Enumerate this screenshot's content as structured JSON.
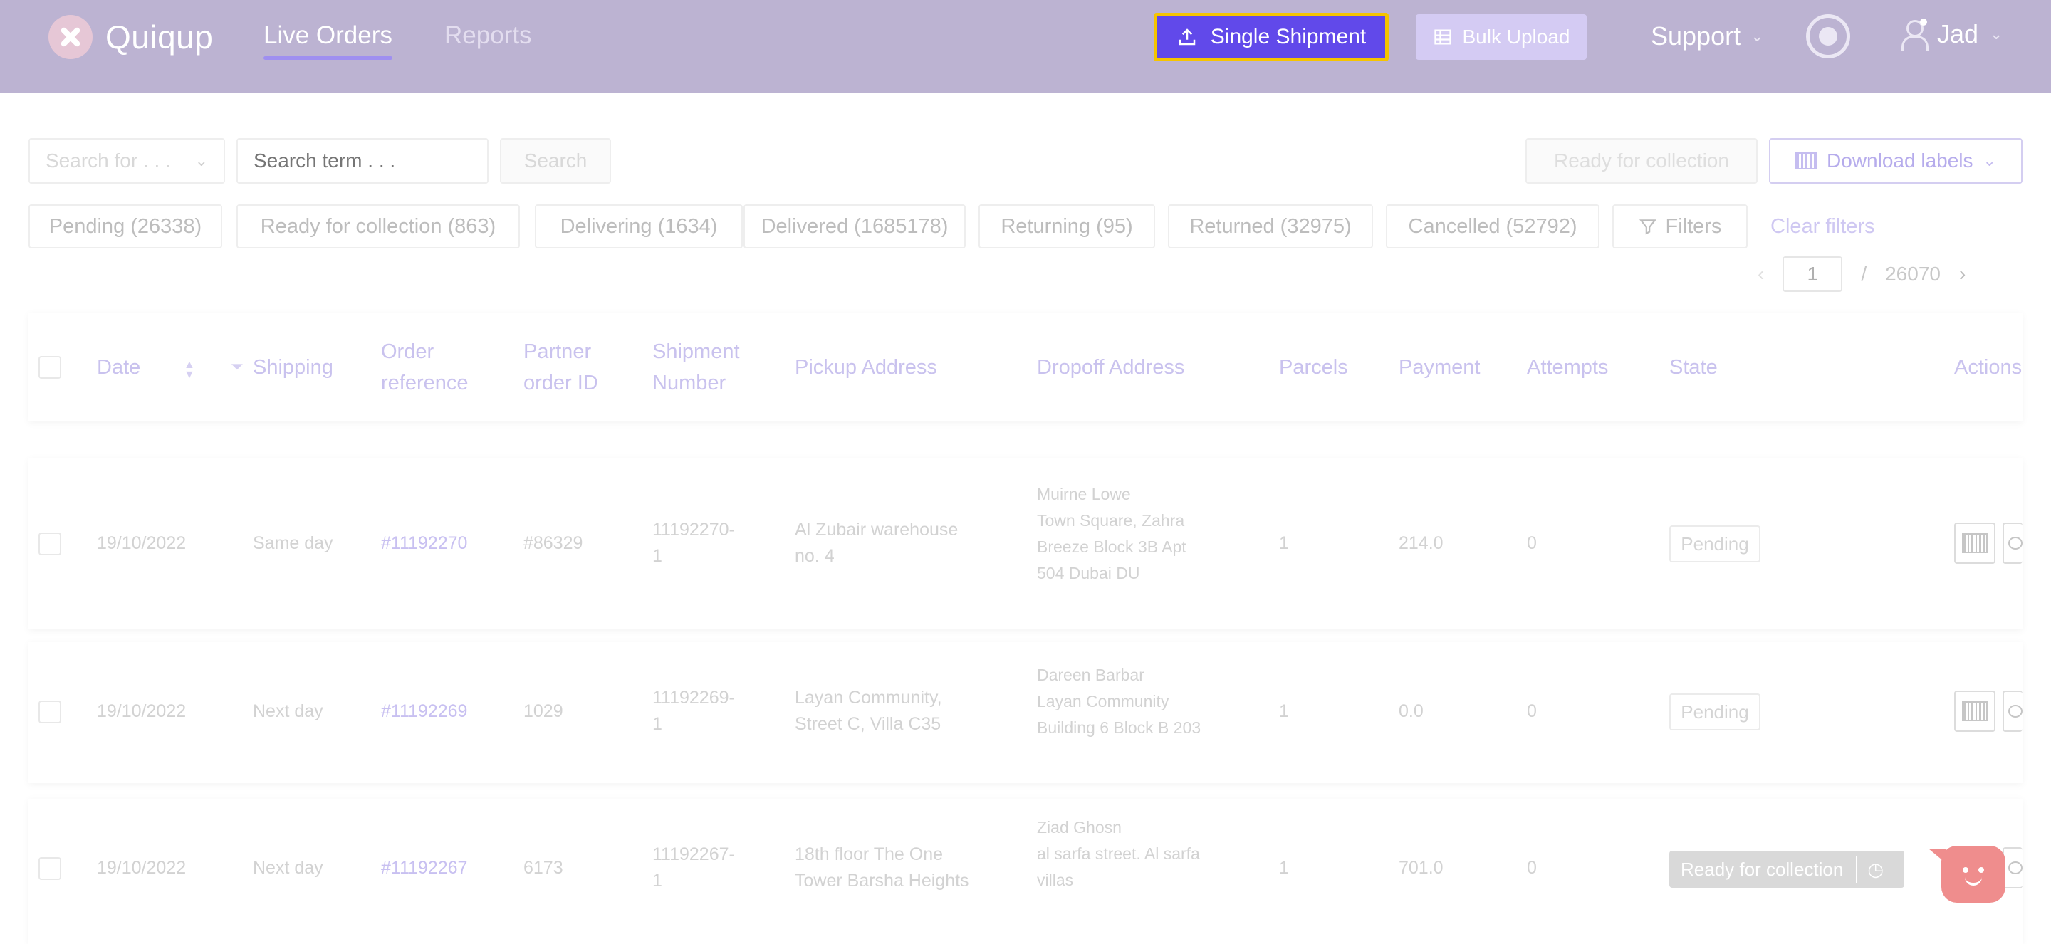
{
  "header": {
    "logo_text": "Quiqup",
    "tabs": [
      "Live Orders",
      "Reports"
    ],
    "single_shipment_label": "Single Shipment",
    "bulk_upload_label": "Bulk Upload",
    "support_label": "Support",
    "user_name": "Jad"
  },
  "search": {
    "search_for_placeholder": "Search for . . .",
    "term_placeholder": "Search term . . .",
    "button_label": "Search",
    "ready_button_label": "Ready for collection",
    "download_labels": "Download labels"
  },
  "filters": {
    "chips": [
      "Pending (26338)",
      "Ready for collection (863)",
      "Delivering (1634)",
      "Delivered (1685178)",
      "Returning (95)",
      "Returned (32975)",
      "Cancelled (52792)",
      "Filters"
    ],
    "clear_label": "Clear filters"
  },
  "pagination": {
    "current_page": "1",
    "separator": "/",
    "total_pages": "26070"
  },
  "table": {
    "headers": {
      "date": "Date",
      "shipping": "Shipping",
      "order_ref_1": "Order",
      "order_ref_2": "reference",
      "partner_1": "Partner",
      "partner_2": "order ID",
      "shipment_1": "Shipment",
      "shipment_2": "Number",
      "pickup": "Pickup Address",
      "dropoff": "Dropoff Address",
      "parcels": "Parcels",
      "payment": "Payment",
      "attempts": "Attempts",
      "state": "State",
      "actions": "Actions"
    },
    "rows": [
      {
        "date": "19/10/2022",
        "shipping": "Same day",
        "order_ref": "#11192270",
        "partner_id": "#86329",
        "shipment_1": "11192270-",
        "shipment_2": "1",
        "pickup_1": "Al Zubair warehouse",
        "pickup_2": "no. 4",
        "dropoff_1": "Muirne Lowe",
        "dropoff_2": "Town Square, Zahra",
        "dropoff_3": "Breeze Block 3B Apt",
        "dropoff_4": "504 Dubai DU",
        "parcels": "1",
        "payment": "214.0",
        "attempts": "0",
        "state": "Pending"
      },
      {
        "date": "19/10/2022",
        "shipping": "Next day",
        "order_ref": "#11192269",
        "partner_id": "1029",
        "shipment_1": "11192269-",
        "shipment_2": "1",
        "pickup_1": "Layan Community,",
        "pickup_2": "Street C, Villa C35",
        "dropoff_1": "Dareen Barbar",
        "dropoff_2": "Layan Community",
        "dropoff_3": "Building 6 Block B 203",
        "dropoff_4": "",
        "parcels": "1",
        "payment": "0.0",
        "attempts": "0",
        "state": "Pending"
      },
      {
        "date": "19/10/2022",
        "shipping": "Next day",
        "order_ref": "#11192267",
        "partner_id": "6173",
        "shipment_1": "11192267-",
        "shipment_2": "1",
        "pickup_1": "18th floor The One",
        "pickup_2": "Tower Barsha Heights",
        "dropoff_1": "Ziad Ghosn",
        "dropoff_2": "al sarfa street. Al sarfa",
        "dropoff_3": "villas",
        "dropoff_4": "",
        "parcels": "1",
        "payment": "701.0",
        "attempts": "0",
        "state": "Ready for collection"
      }
    ]
  }
}
